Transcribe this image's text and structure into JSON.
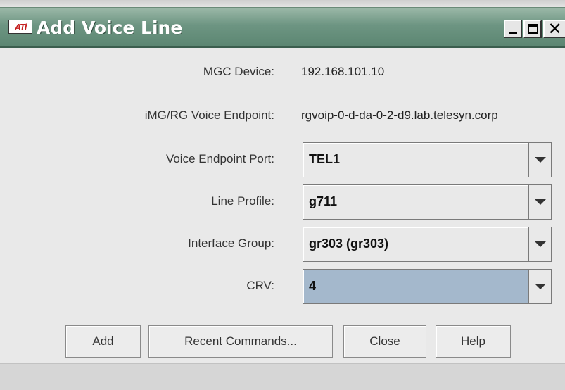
{
  "window": {
    "title": "Add Voice Line",
    "icon_label": "ATi",
    "controls": {
      "minimize": "minimize-icon",
      "maximize": "maximize-icon",
      "close": "close-icon"
    }
  },
  "form": {
    "mgc_device": {
      "label": "MGC Device:",
      "value": "192.168.101.10"
    },
    "voice_endpoint": {
      "label": "iMG/RG Voice Endpoint:",
      "value": "rgvoip-0-d-da-0-2-d9.lab.telesyn.corp"
    },
    "endpoint_port": {
      "label": "Voice Endpoint Port:",
      "value": "TEL1"
    },
    "line_profile": {
      "label": "Line Profile:",
      "value": "g711"
    },
    "interface_group": {
      "label": "Interface Group:",
      "value": "gr303 (gr303)"
    },
    "crv": {
      "label": "CRV:",
      "value": "4"
    }
  },
  "buttons": {
    "add": "Add",
    "recent_commands": "Recent Commands...",
    "close": "Close",
    "help": "Help"
  },
  "colors": {
    "titlebar": "#6d9582",
    "selected_field": "#a4b8cc"
  }
}
